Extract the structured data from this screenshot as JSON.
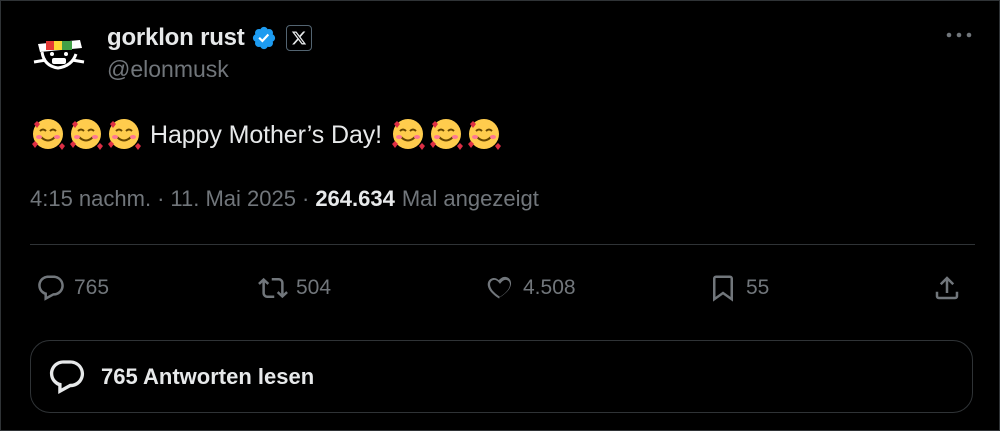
{
  "author": {
    "display_name": "gorklon rust",
    "handle": "@elonmusk",
    "avatar_icon": "cartoon-face-avatar",
    "verified_color": "#1d9bf0"
  },
  "tweet": {
    "text": "Happy Mother’s Day!",
    "leading_emojis": [
      "smiling-face-with-hearts",
      "smiling-face-with-hearts",
      "smiling-face-with-hearts"
    ],
    "trailing_emojis": [
      "smiling-face-with-hearts",
      "smiling-face-with-hearts",
      "smiling-face-with-hearts"
    ]
  },
  "meta": {
    "time": "4:15 nachm.",
    "separator": "·",
    "date": "11. Mai 2025",
    "views_count": "264.634",
    "views_label": "Mal angezeigt"
  },
  "actions": {
    "replies": "765",
    "reposts": "504",
    "likes": "4.508",
    "bookmarks": "55"
  },
  "read_replies": {
    "label": "765 Antworten lesen"
  },
  "colors": {
    "background": "#000000",
    "text_primary": "#e7e9ea",
    "text_secondary": "#71767b",
    "border": "#2f3336"
  }
}
